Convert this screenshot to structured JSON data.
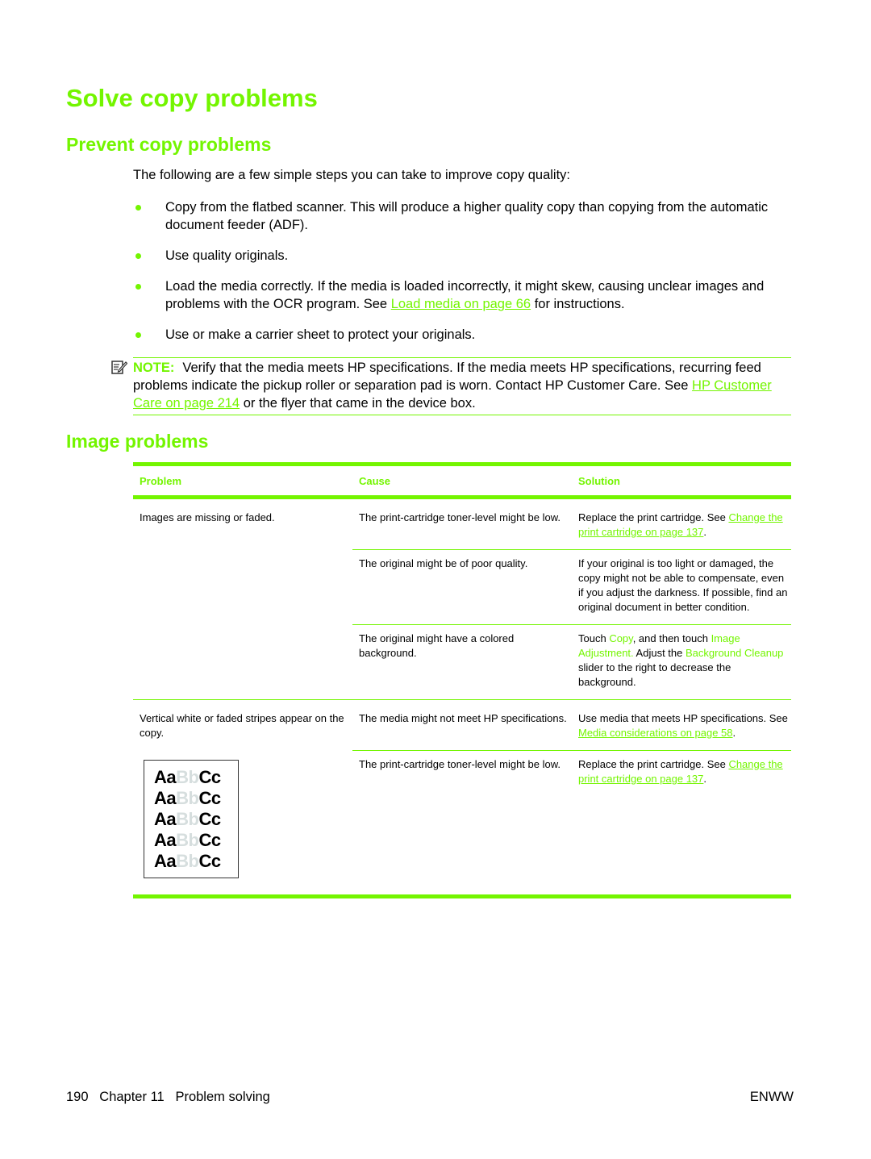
{
  "page_title": "Solve copy problems",
  "prevent": {
    "heading": "Prevent copy problems",
    "intro": "The following are a few simple steps you can take to improve copy quality:",
    "bullets": [
      {
        "text": "Copy from the flatbed scanner. This will produce a higher quality copy than copying from the automatic document feeder (ADF)."
      },
      {
        "text": "Use quality originals."
      },
      {
        "text_before": "Load the media correctly. If the media is loaded incorrectly, it might skew, causing unclear images and problems with the OCR program. See ",
        "link": "Load media on page 66",
        "text_after": " for instructions."
      },
      {
        "text": "Use or make a carrier sheet to protect your originals."
      }
    ],
    "note": {
      "label": "NOTE:",
      "text_before": "Verify that the media meets HP specifications. If the media meets HP specifications, recurring feed problems indicate the pickup roller or separation pad is worn. Contact HP Customer Care. See ",
      "link": "HP Customer Care on page 214",
      "text_after": " or the flyer that came in the device box."
    }
  },
  "image_problems": {
    "heading": "Image problems",
    "columns": [
      "Problem",
      "Cause",
      "Solution"
    ],
    "groups": [
      {
        "problem": "Images are missing or faded.",
        "rows": [
          {
            "cause": "The print-cartridge toner-level might be low.",
            "solution_before": "Replace the print cartridge. See ",
            "solution_link": "Change the print cartridge on page 137",
            "solution_after": "."
          },
          {
            "cause": "The original might be of poor quality.",
            "solution": "If your original is too light or damaged, the copy might not be able to compensate, even if you adjust the darkness. If possible, find an original document in better condition."
          },
          {
            "cause": "The original might have a colored background.",
            "solution_parts": [
              "Touch ",
              "Copy",
              ", and then touch ",
              "Image Adjustment.",
              " Adjust the ",
              "Background Cleanup",
              " slider to the right to decrease the background."
            ]
          }
        ]
      },
      {
        "problem": "Vertical white or faded stripes appear on the copy.",
        "sample_lines": [
          {
            "dark1": "Aa",
            "faded": "Bb",
            "dark2": "Cc"
          },
          {
            "dark1": "Aa",
            "faded": "Bb",
            "dark2": "Cc"
          },
          {
            "dark1": "Aa",
            "faded": "Bb",
            "dark2": "Cc"
          },
          {
            "dark1": "Aa",
            "faded": "Bb",
            "dark2": "Cc"
          },
          {
            "dark1": "Aa",
            "faded": "Bb",
            "dark2": "Cc"
          }
        ],
        "rows": [
          {
            "cause": "The media might not meet HP specifications.",
            "solution_before": "Use media that meets HP specifications. See ",
            "solution_link": "Media considerations on page 58",
            "solution_after": "."
          },
          {
            "cause": "The print-cartridge toner-level might be low.",
            "solution_before": "Replace the print cartridge. See ",
            "solution_link": "Change the print cartridge on page 137",
            "solution_after": "."
          }
        ]
      }
    ]
  },
  "footer": {
    "left": "190   Chapter 11   Problem solving",
    "right": "ENWW"
  },
  "colors": {
    "accent": "#73F500"
  }
}
